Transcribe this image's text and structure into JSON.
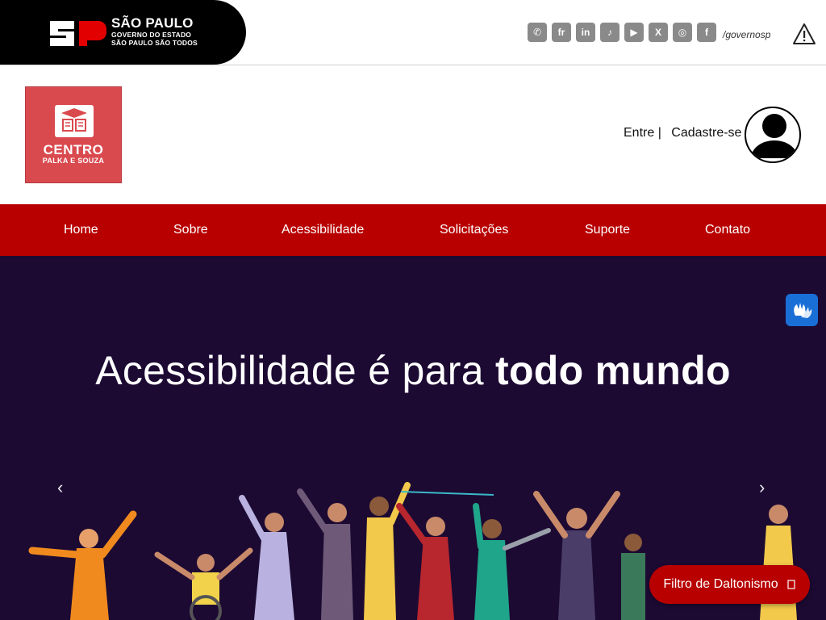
{
  "gov": {
    "title": "SÃO PAULO",
    "line2": "GOVERNO DO ESTADO",
    "line3": "SÃO PAULO SÃO TODOS",
    "logo_mark": "SP",
    "social": [
      "whatsapp",
      "flickr",
      "linkedin",
      "tiktok",
      "youtube",
      "x",
      "instagram",
      "facebook"
    ],
    "social_glyphs": [
      "✆",
      "fr",
      "in",
      "♪",
      "▶",
      "X",
      "◎",
      "f"
    ],
    "handle": "/governosp"
  },
  "brand": {
    "line1": "CENTRO",
    "line2": "PALKA E SOUZA"
  },
  "auth": {
    "login": "Entre |",
    "signup": "Cadastre-se"
  },
  "nav": {
    "items": [
      {
        "label": "Home"
      },
      {
        "label": "Sobre"
      },
      {
        "label": "Acessibilidade"
      },
      {
        "label": "Solicitações"
      },
      {
        "label": "Suporte"
      },
      {
        "label": "Contato"
      }
    ]
  },
  "hero": {
    "title_light": "Acessibilidade é para",
    "title_bold": "todo mundo",
    "prev": "‹",
    "next": "›"
  },
  "widgets": {
    "color_filter_label": "Filtro de Daltonismo",
    "color_filter_icon": "eye-icon"
  },
  "colors": {
    "nav_red": "#b80000",
    "hero_bg": "#1c0a33",
    "brand_red": "#d94a4f"
  }
}
